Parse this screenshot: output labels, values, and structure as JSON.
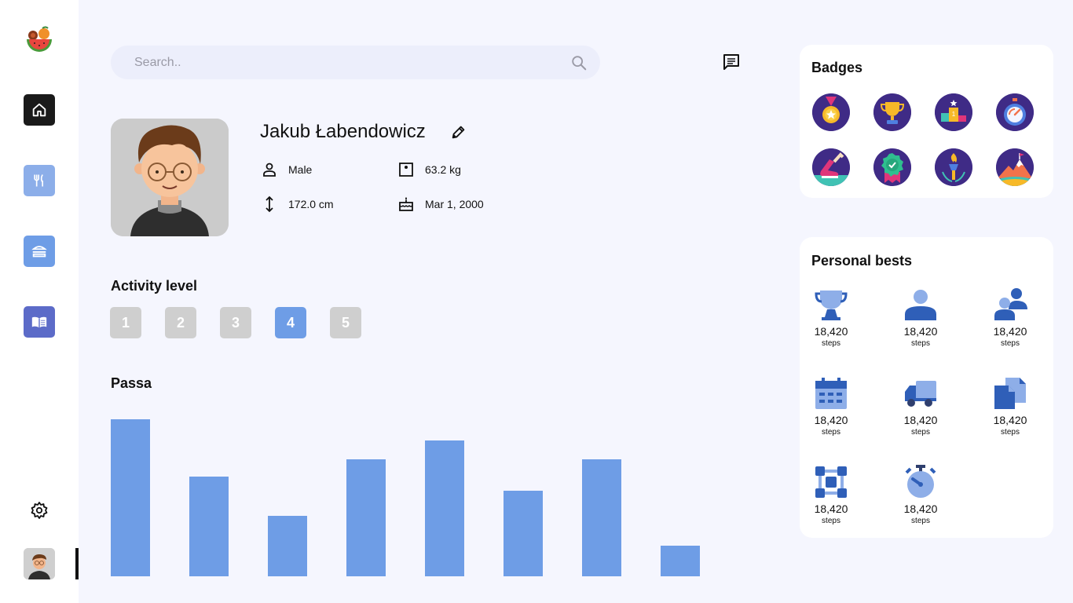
{
  "search": {
    "placeholder": "Search.."
  },
  "profile": {
    "name": "Jakub Łabendowicz",
    "gender": "Male",
    "weight": "63.2 kg",
    "height": "172.0 cm",
    "birthdate": "Mar 1, 2000"
  },
  "activity": {
    "title": "Activity level",
    "levels": [
      "1",
      "2",
      "3",
      "4",
      "5"
    ],
    "selected": "4"
  },
  "chart_data": {
    "type": "bar",
    "title": "Passa",
    "values": [
      200,
      127,
      77,
      149,
      173,
      109,
      149,
      39
    ],
    "ylim": [
      0,
      222
    ],
    "color": "#6e9de6"
  },
  "badges": {
    "title": "Badges",
    "items": [
      "medal-badge",
      "trophy-badge",
      "podium-badge",
      "stopwatch-badge",
      "sneaker-badge",
      "ribbon-badge",
      "torch-badge",
      "mountain-badge"
    ]
  },
  "bests": {
    "title": "Personal bests",
    "items": [
      {
        "icon": "trophy-icon",
        "value": "18,420",
        "unit": "steps"
      },
      {
        "icon": "user-icon",
        "value": "18,420",
        "unit": "steps"
      },
      {
        "icon": "users-icon",
        "value": "18,420",
        "unit": "steps"
      },
      {
        "icon": "calendar-icon",
        "value": "18,420",
        "unit": "steps"
      },
      {
        "icon": "truck-icon",
        "value": "18,420",
        "unit": "steps"
      },
      {
        "icon": "documents-icon",
        "value": "18,420",
        "unit": "steps"
      },
      {
        "icon": "network-icon",
        "value": "18,420",
        "unit": "steps"
      },
      {
        "icon": "timer-icon",
        "value": "18,420",
        "unit": "steps"
      }
    ]
  },
  "colors": {
    "accent": "#6e9de6",
    "background": "#f5f6fe",
    "inactive": "#cfcfcf",
    "badge_bg": "#3f2b86"
  }
}
